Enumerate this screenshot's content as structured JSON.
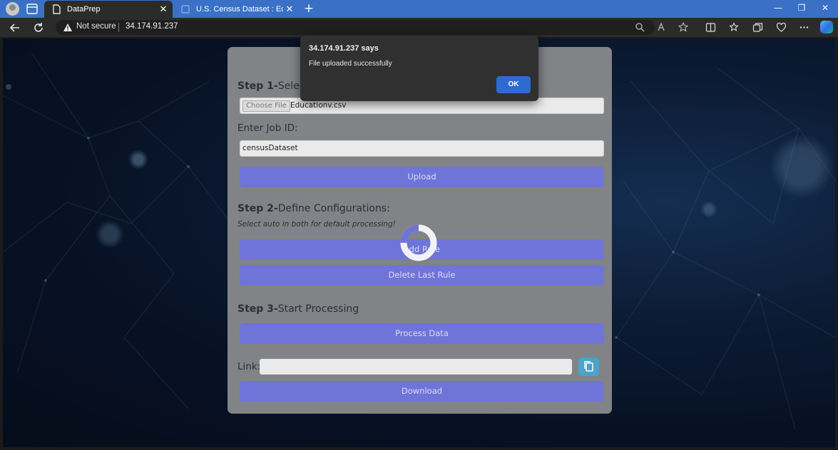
{
  "browser": {
    "tabs": [
      {
        "title": "DataPrep",
        "active": true
      },
      {
        "title": "U.S. Census Dataset : Education",
        "active": false
      }
    ],
    "security_label": "Not secure",
    "url": "34.174.91.237",
    "icons": [
      "profile-icon",
      "tab-actions-icon",
      "page-icon",
      "close-icon",
      "new-tab-icon",
      "back-icon",
      "refresh-icon",
      "warning-icon",
      "zoom-icon",
      "read-aloud-icon",
      "favorite-icon",
      "split-screen-icon",
      "favorites-icon",
      "collections-icon",
      "browser-essentials-icon",
      "more-icon",
      "copilot-icon"
    ]
  },
  "form": {
    "step1": {
      "bold": "Step 1-",
      "text": "Select"
    },
    "choose_file_label": "Choose File",
    "file_name": "Educationv.csv",
    "job_id_label": "Enter Job ID:",
    "job_id_value": "censusDataset",
    "upload_label": "Upload",
    "step2": {
      "bold": "Step 2-",
      "text": "Define Configurations:"
    },
    "step2_hint": "Select auto in both for default processing!",
    "add_rule_label": "Add Rule",
    "delete_rule_label": "Delete Last Rule",
    "step3": {
      "bold": "Step 3-",
      "text": "Start Processing"
    },
    "process_label": "Process Data",
    "link_label": "Link:",
    "link_value": "",
    "download_label": "Download"
  },
  "alert": {
    "title": "34.174.91.237 says",
    "message": "File uploaded successfully",
    "ok_label": "OK"
  },
  "colors": {
    "tabbar": "#3a71c6",
    "card": "#818387",
    "button": "#6f74d8",
    "copy_button": "#4aa3c9",
    "alert_ok": "#2d6bd3"
  }
}
